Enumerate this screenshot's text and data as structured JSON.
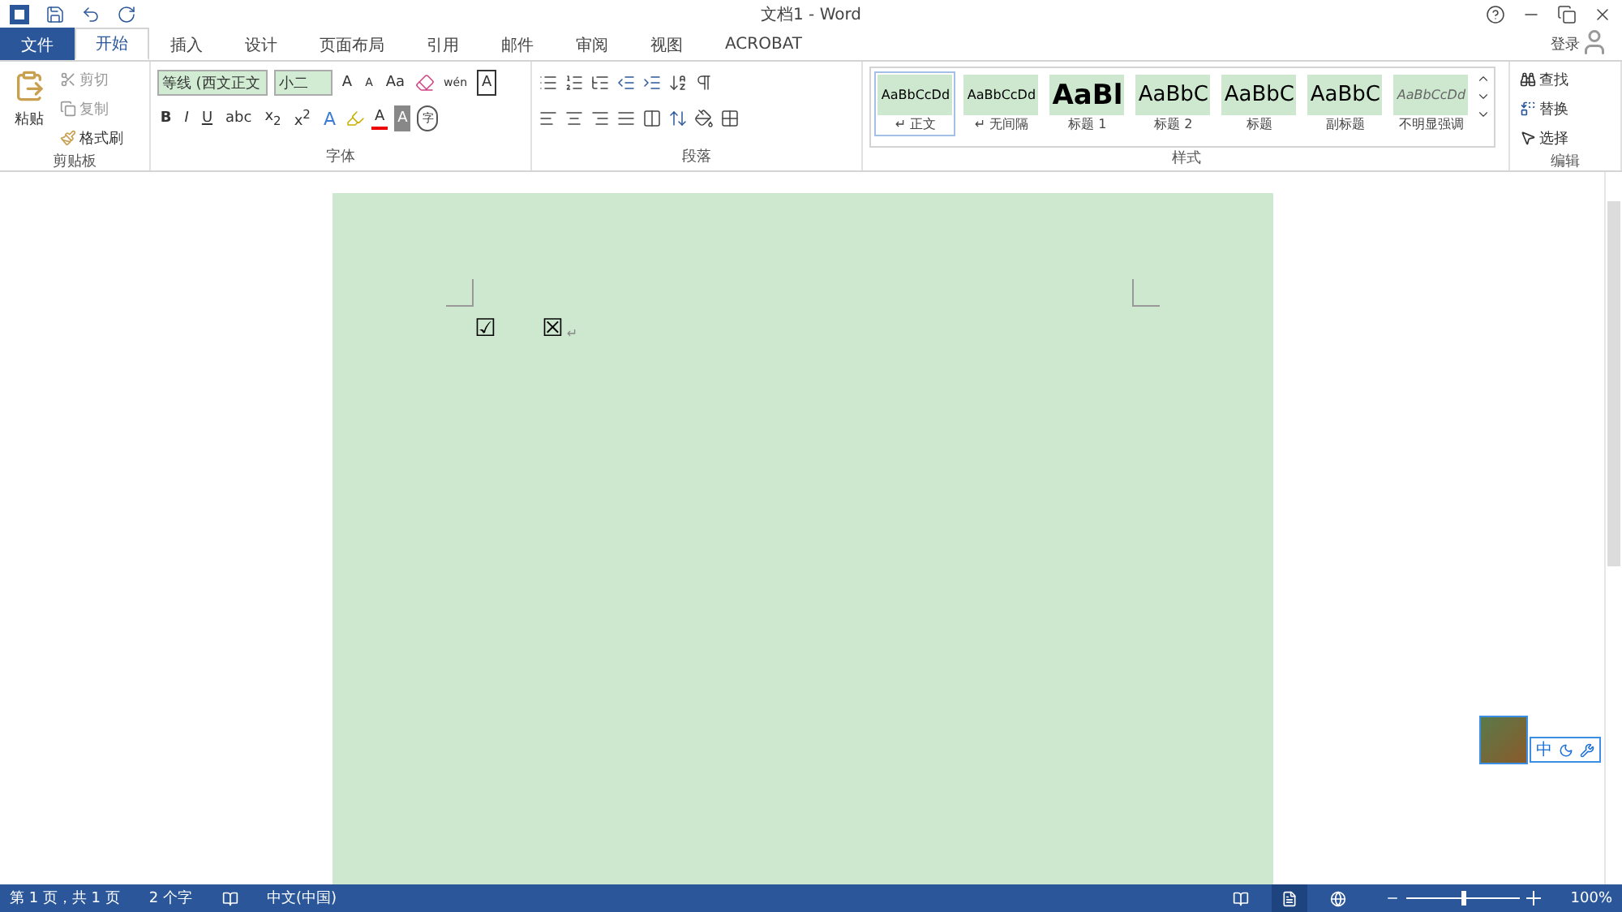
{
  "window": {
    "title": "文档1 - Word",
    "signin": "登录"
  },
  "tabs": [
    {
      "label": "文件",
      "kind": "file",
      "selected": false
    },
    {
      "label": "开始",
      "kind": "tab",
      "selected": true
    },
    {
      "label": "插入",
      "kind": "tab",
      "selected": false
    },
    {
      "label": "设计",
      "kind": "tab",
      "selected": false
    },
    {
      "label": "页面布局",
      "kind": "tab",
      "selected": false
    },
    {
      "label": "引用",
      "kind": "tab",
      "selected": false
    },
    {
      "label": "邮件",
      "kind": "tab",
      "selected": false
    },
    {
      "label": "审阅",
      "kind": "tab",
      "selected": false
    },
    {
      "label": "视图",
      "kind": "tab",
      "selected": false
    },
    {
      "label": "ACROBAT",
      "kind": "tab",
      "selected": false
    }
  ],
  "clipboard": {
    "paste": "粘贴",
    "cut": "剪切",
    "copy": "复制",
    "painter": "格式刷",
    "label": "剪贴板"
  },
  "font": {
    "name": "等线 (西文正文",
    "size": "小二",
    "grow": "A",
    "shrink": "A",
    "case": "Aa",
    "phonetic": "wén",
    "border": "A",
    "format_buttons": [
      "B",
      "I",
      "U",
      "abc",
      "x$_{2}$",
      "x$^{2}$"
    ],
    "effects": "A",
    "font_color": "A",
    "shading": "A",
    "enclose": "字",
    "label": "字体"
  },
  "paragraph": {
    "label": "段落"
  },
  "styles": {
    "label": "样式",
    "items": [
      {
        "preview": "AaBbCcDd",
        "name": "↵ 正文",
        "kind": "normal",
        "selected": true
      },
      {
        "preview": "AaBbCcDd",
        "name": "↵ 无间隔",
        "kind": "normal",
        "selected": false
      },
      {
        "preview": "AaBl",
        "name": "标题 1",
        "kind": "heading1",
        "selected": false
      },
      {
        "preview": "AaBbC",
        "name": "标题 2",
        "kind": "heading",
        "selected": false
      },
      {
        "preview": "AaBbC",
        "name": "标题",
        "kind": "heading",
        "selected": false
      },
      {
        "preview": "AaBbC",
        "name": "副标题",
        "kind": "heading",
        "selected": false
      },
      {
        "preview": "AaBbCcDd",
        "name": "不明显强调",
        "kind": "subtle",
        "selected": false
      }
    ]
  },
  "editing": {
    "label": "编辑",
    "find": "查找",
    "replace": "替换",
    "select": "选择"
  },
  "document": {
    "symbols": [
      "☑",
      "☒"
    ],
    "paragraph_mark": "↵"
  },
  "ime": {
    "label": "中"
  },
  "status_bar": {
    "page": "第 1 页，共 1 页",
    "words": "2 个字",
    "language": "中文(中国)",
    "zoom": "100%",
    "zoom_slider": {
      "level": 0.5
    },
    "views": [
      {
        "kind": "read",
        "selected": false
      },
      {
        "kind": "print",
        "selected": true
      },
      {
        "kind": "web",
        "selected": false
      }
    ]
  }
}
